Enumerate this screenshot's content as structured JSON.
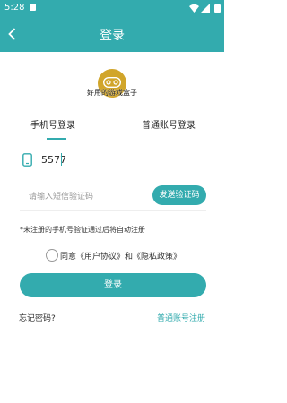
{
  "status_bar": {
    "time": "5:28"
  },
  "header": {
    "title": "登录",
    "back_icon": "chevron-left-icon"
  },
  "app": {
    "name": "好用的游戏盒子",
    "logo_icon": "gamepad-icon"
  },
  "tabs": [
    {
      "label": "手机号登录",
      "active": true
    },
    {
      "label": "普通账号登录",
      "active": false
    }
  ],
  "phone_field": {
    "icon": "phone-icon",
    "value": "5577"
  },
  "sms_field": {
    "placeholder": "请输入短信验证码",
    "send_button_label": "发送验证码"
  },
  "notice": "*未注册的手机号验证通过后将自动注册",
  "agreement": {
    "text": "同意《用户协议》和《隐私政策》",
    "checked": false
  },
  "login_button_label": "登录",
  "links": {
    "forgot_password": "忘记密码?",
    "account_register": "普通账号注册"
  },
  "colors": {
    "accent": "#33ABAE",
    "text": "#222222",
    "placeholder": "#9A9A9A"
  }
}
